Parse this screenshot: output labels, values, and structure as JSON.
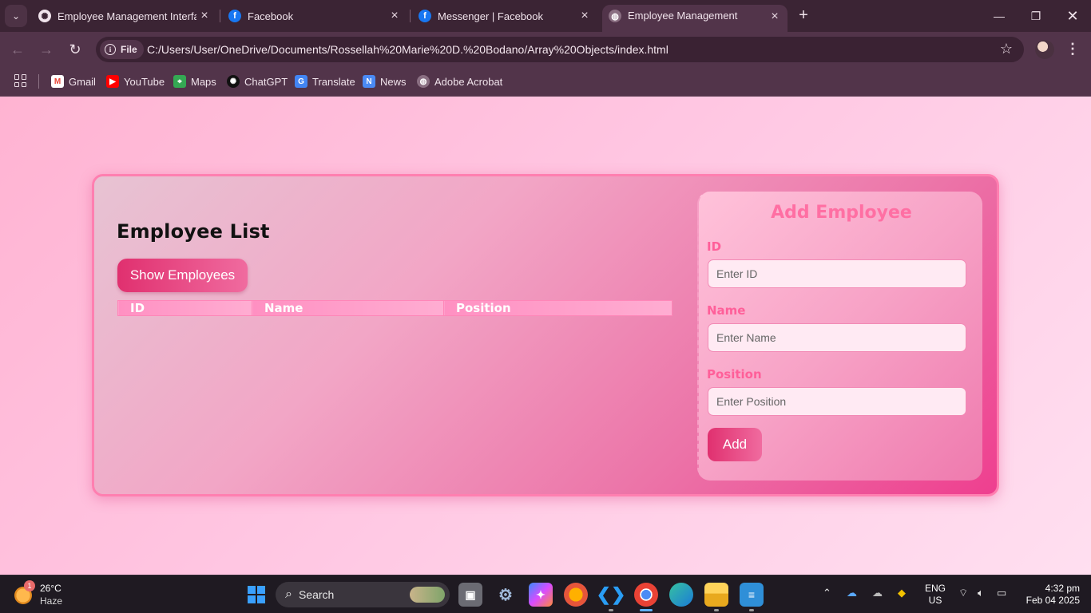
{
  "browser": {
    "tabs": [
      {
        "title": "Employee Management Interface",
        "favicon": "chatgpt-icon"
      },
      {
        "title": "Facebook",
        "favicon": "facebook-icon"
      },
      {
        "title": "Messenger | Facebook",
        "favicon": "facebook-icon"
      },
      {
        "title": "Employee Management",
        "favicon": "globe-icon",
        "active": true
      }
    ],
    "address": {
      "scheme_chip": "File",
      "url": "C:/Users/User/OneDrive/Documents/Rossellah%20Marie%20D.%20Bodano/Array%20Objects/index.html"
    },
    "bookmarks": [
      {
        "label": "Gmail",
        "icon": "gmail-icon"
      },
      {
        "label": "YouTube",
        "icon": "youtube-icon"
      },
      {
        "label": "Maps",
        "icon": "maps-icon"
      },
      {
        "label": "ChatGPT",
        "icon": "chatgpt-icon"
      },
      {
        "label": "Translate",
        "icon": "translate-icon"
      },
      {
        "label": "News",
        "icon": "news-icon"
      },
      {
        "label": "Adobe Acrobat",
        "icon": "globe-icon"
      }
    ]
  },
  "page": {
    "list": {
      "title": "Employee List",
      "show_button": "Show Employees",
      "columns": [
        "ID",
        "Name",
        "Position"
      ],
      "rows": []
    },
    "form": {
      "title": "Add Employee",
      "fields": [
        {
          "label": "ID",
          "placeholder": "Enter ID",
          "value": ""
        },
        {
          "label": "Name",
          "placeholder": "Enter Name",
          "value": ""
        },
        {
          "label": "Position",
          "placeholder": "Enter Position",
          "value": ""
        }
      ],
      "submit_button": "Add"
    },
    "colors": {
      "accent": "#e0306f",
      "label_pink": "#ff5f99",
      "background_pink": "#ffc6e2"
    }
  },
  "taskbar": {
    "weather": {
      "temp": "26°C",
      "condition": "Haze",
      "badge": "1"
    },
    "search_placeholder": "Search",
    "language": {
      "line1": "ENG",
      "line2": "US"
    },
    "clock": {
      "time": "4:32 pm",
      "date": "Feb 04 2025"
    }
  }
}
